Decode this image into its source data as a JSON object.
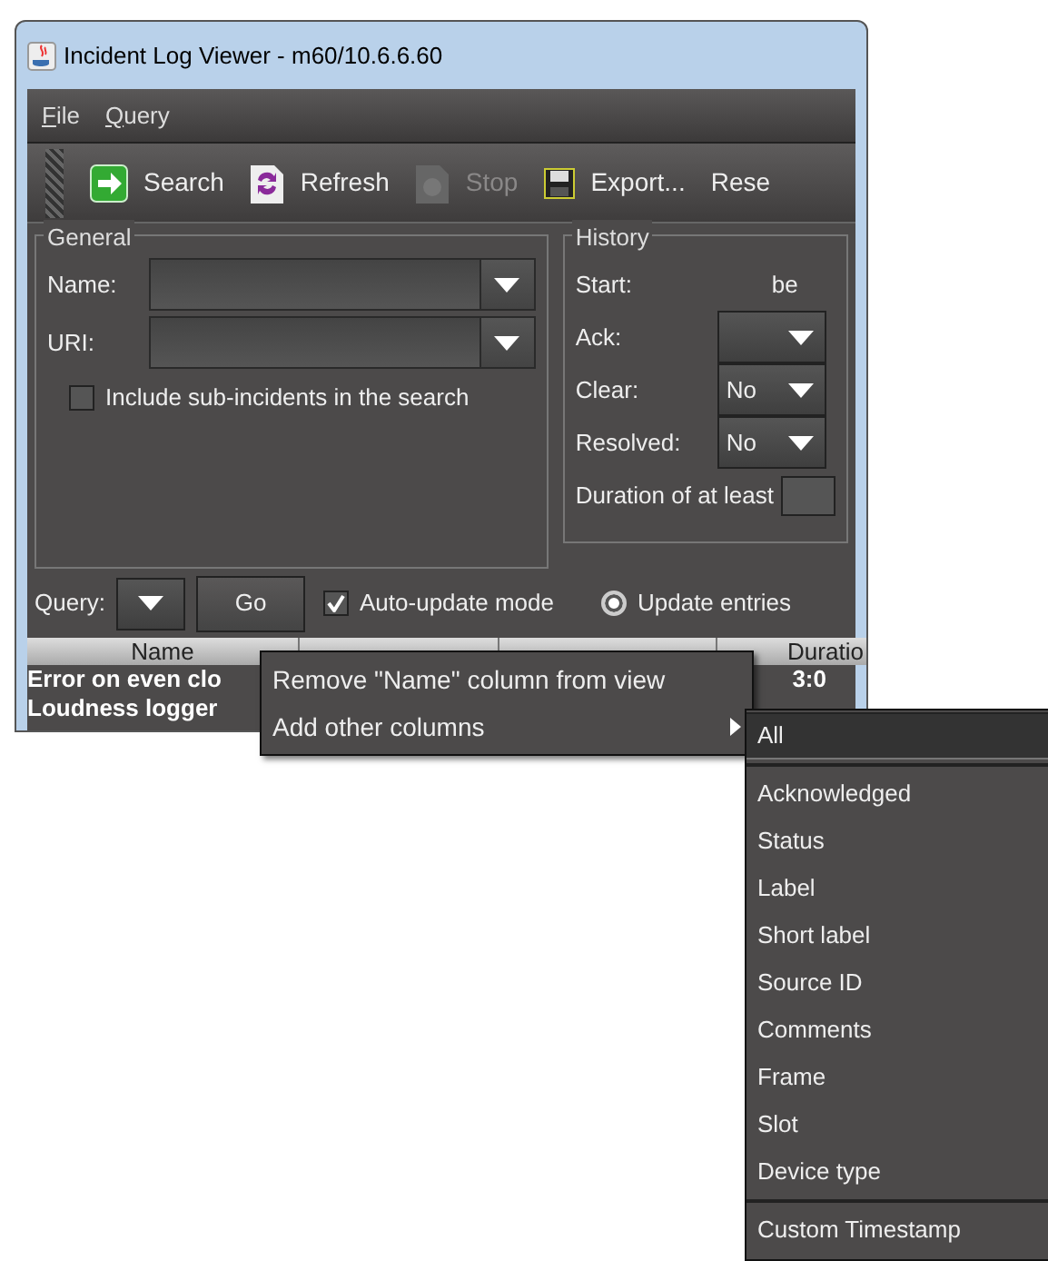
{
  "window": {
    "title": "Incident Log Viewer - m60/10.6.6.60"
  },
  "menu_bar": [
    {
      "label": "File"
    },
    {
      "label": "Query"
    }
  ],
  "toolbar": [
    {
      "label": "Search",
      "disabled": false
    },
    {
      "label": "Refresh",
      "disabled": false
    },
    {
      "label": "Stop",
      "disabled": true
    },
    {
      "label": "Export...",
      "disabled": false
    },
    {
      "label": "Rese",
      "disabled": false
    }
  ],
  "general": {
    "title": "General",
    "fields": [
      {
        "label": "Name:"
      },
      {
        "label": "URI:"
      }
    ],
    "checkbox": {
      "label": "Include sub-incidents in the search",
      "checked": false
    }
  },
  "history": {
    "title": "History",
    "start_label": "Start:",
    "start_value": "be",
    "rows": [
      {
        "label": "Ack:"
      },
      {
        "label": "Clear:",
        "value": "No"
      },
      {
        "label": "Resolved:",
        "value": "No"
      }
    ],
    "duration_label": "Duration of at least"
  },
  "query_bar": {
    "label": "Query:",
    "go": "Go",
    "auto_update": {
      "label": "Auto-update mode",
      "checked": true
    },
    "update_entries": {
      "label": "Update entries",
      "selected": true
    }
  },
  "table": {
    "columns": [
      "Name",
      "Duratio"
    ],
    "rows": [
      {
        "name": "Error on even clo",
        "duration": "3:0"
      },
      {
        "name": "Loudness logger"
      }
    ]
  },
  "context_menu": {
    "items": [
      {
        "label": "Remove \"Name\" column from view",
        "kind": "item",
        "selected": false
      },
      {
        "label": "Add other columns",
        "kind": "submenu",
        "selected": false
      }
    ]
  },
  "submenu": {
    "items": [
      {
        "label": "All",
        "kind": "item",
        "selected": true
      },
      {
        "kind": "separator"
      },
      {
        "label": "Acknowledged",
        "kind": "item",
        "selected": false
      },
      {
        "label": "Status",
        "kind": "item",
        "selected": false
      },
      {
        "label": "Label",
        "kind": "item",
        "selected": false
      },
      {
        "label": "Short label",
        "kind": "item",
        "selected": false
      },
      {
        "label": "Source ID",
        "kind": "item",
        "selected": false
      },
      {
        "label": "Comments",
        "kind": "item",
        "selected": false
      },
      {
        "label": "Frame",
        "kind": "item",
        "selected": false
      },
      {
        "label": "Slot",
        "kind": "item",
        "selected": false
      },
      {
        "label": "Device type",
        "kind": "item",
        "selected": false
      },
      {
        "kind": "separator"
      },
      {
        "label": "Custom Timestamp",
        "kind": "item",
        "selected": false
      }
    ]
  }
}
